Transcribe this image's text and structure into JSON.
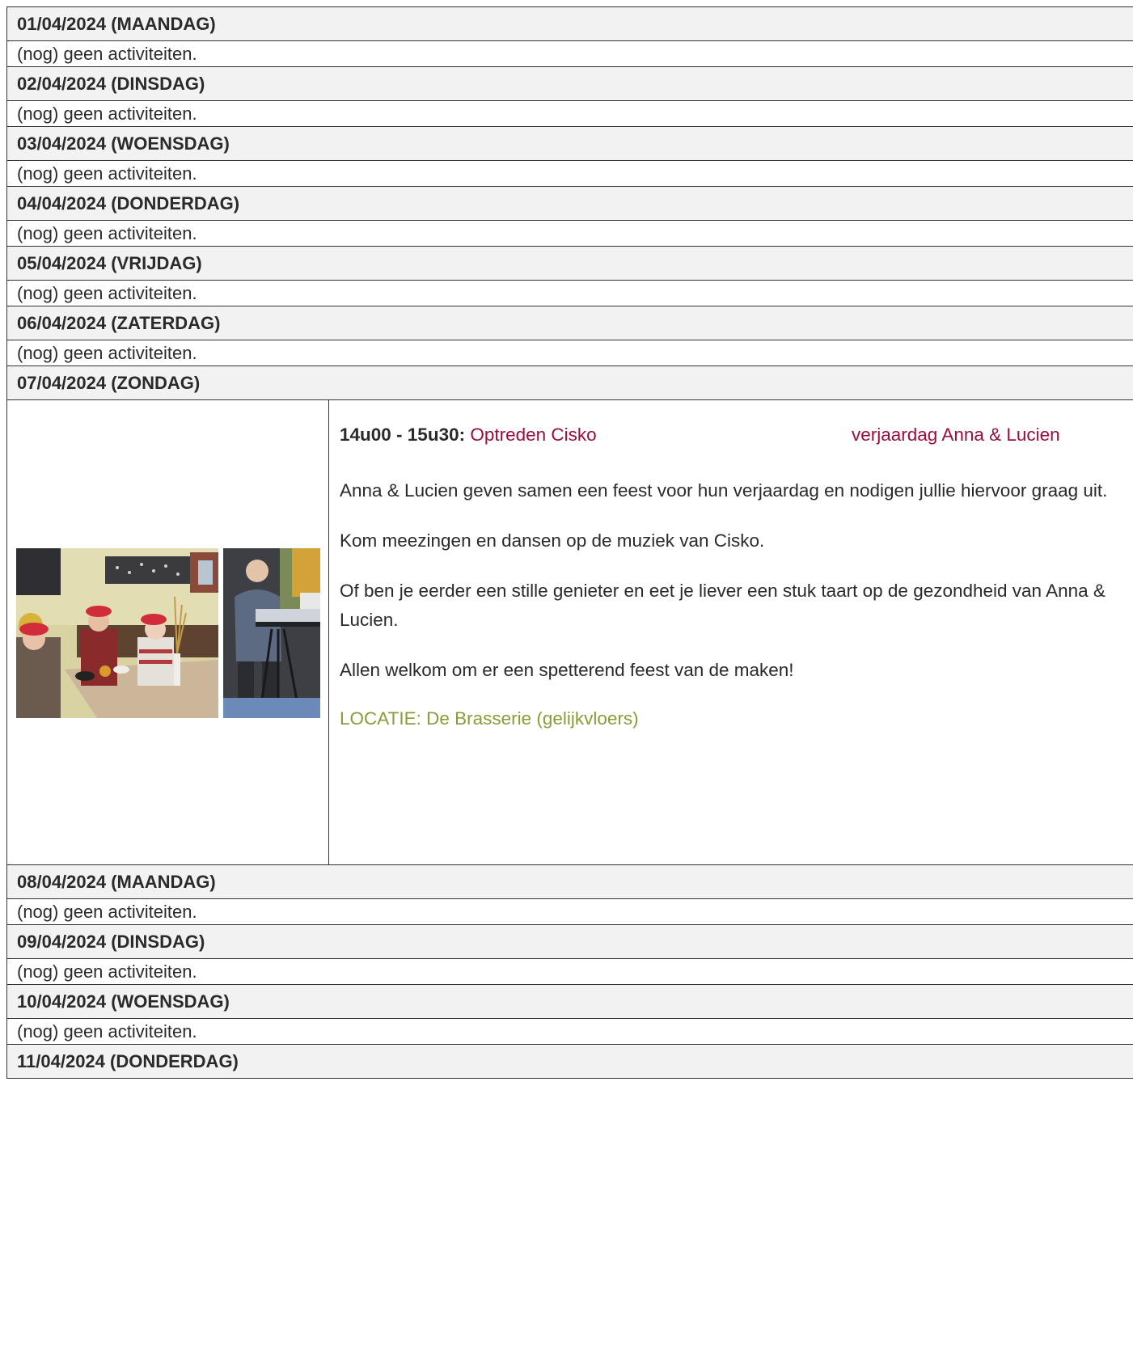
{
  "days": [
    {
      "header": "01/04/2024 (MAANDAG)",
      "empty": "(nog) geen activiteiten."
    },
    {
      "header": "02/04/2024 (DINSDAG)",
      "empty": "(nog) geen activiteiten."
    },
    {
      "header": "03/04/2024 (WOENSDAG)",
      "empty": "(nog) geen activiteiten."
    },
    {
      "header": "04/04/2024 (DONDERDAG)",
      "empty": "(nog) geen activiteiten."
    },
    {
      "header": "05/04/2024 (VRIJDAG)",
      "empty": "(nog) geen activiteiten."
    },
    {
      "header": "06/04/2024 (ZATERDAG)",
      "empty": "(nog) geen activiteiten."
    },
    {
      "header": "07/04/2024 (ZONDAG)"
    },
    {
      "header": "08/04/2024 (MAANDAG)",
      "empty": "(nog) geen activiteiten."
    },
    {
      "header": "09/04/2024 (DINSDAG)",
      "empty": "(nog) geen activiteiten."
    },
    {
      "header": "10/04/2024 (WOENSDAG)",
      "empty": "(nog) geen activiteiten."
    },
    {
      "header": "11/04/2024 (DONDERDAG)"
    }
  ],
  "event": {
    "time": "14u00 - 15u30:",
    "title": "Optreden Cisko",
    "subtitle": "verjaardag Anna & Lucien",
    "paragraphs": [
      "Anna & Lucien geven samen een feest voor hun verjaardag en nodigen jullie hiervoor graag uit.",
      "Kom meezingen en dansen op de muziek van Cisko.",
      "Of ben je eerder een stille genieter en eet je liever een stuk taart op de gezondheid van Anna &  Lucien.",
      "Allen welkom om er een spetterend feest van de maken!"
    ],
    "location": "LOCATIE: De Brasserie (gelijkvloers)",
    "photos": [
      "party-photo",
      "singer-photo"
    ]
  },
  "colors": {
    "header_bg": "#f2f2f2",
    "border": "#333333",
    "event_accent": "#9b0e3c",
    "location": "#8e9a38"
  }
}
